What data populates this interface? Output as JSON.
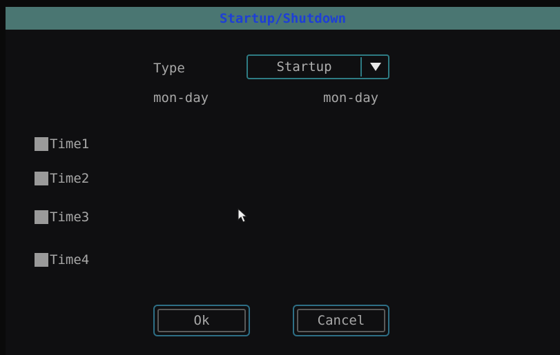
{
  "dialog": {
    "title": "Startup/Shutdown"
  },
  "type_field": {
    "label": "Type",
    "selected": "Startup"
  },
  "columns": {
    "start_label": "mon-day",
    "end_label": "mon-day"
  },
  "times": [
    {
      "label": "Time1",
      "checked": false
    },
    {
      "label": "Time2",
      "checked": false
    },
    {
      "label": "Time3",
      "checked": false
    },
    {
      "label": "Time4",
      "checked": false
    }
  ],
  "buttons": {
    "ok_label": "Ok",
    "cancel_label": "Cancel"
  },
  "icons": {
    "dropdown": "triangle-down-icon",
    "cursor": "mouse-pointer-icon"
  },
  "colors": {
    "title_bar": "#4a7672",
    "title_text": "#1e3fd6",
    "accent_border": "#2e7c84",
    "text": "#a8a8a8",
    "background": "#0f0f11"
  }
}
